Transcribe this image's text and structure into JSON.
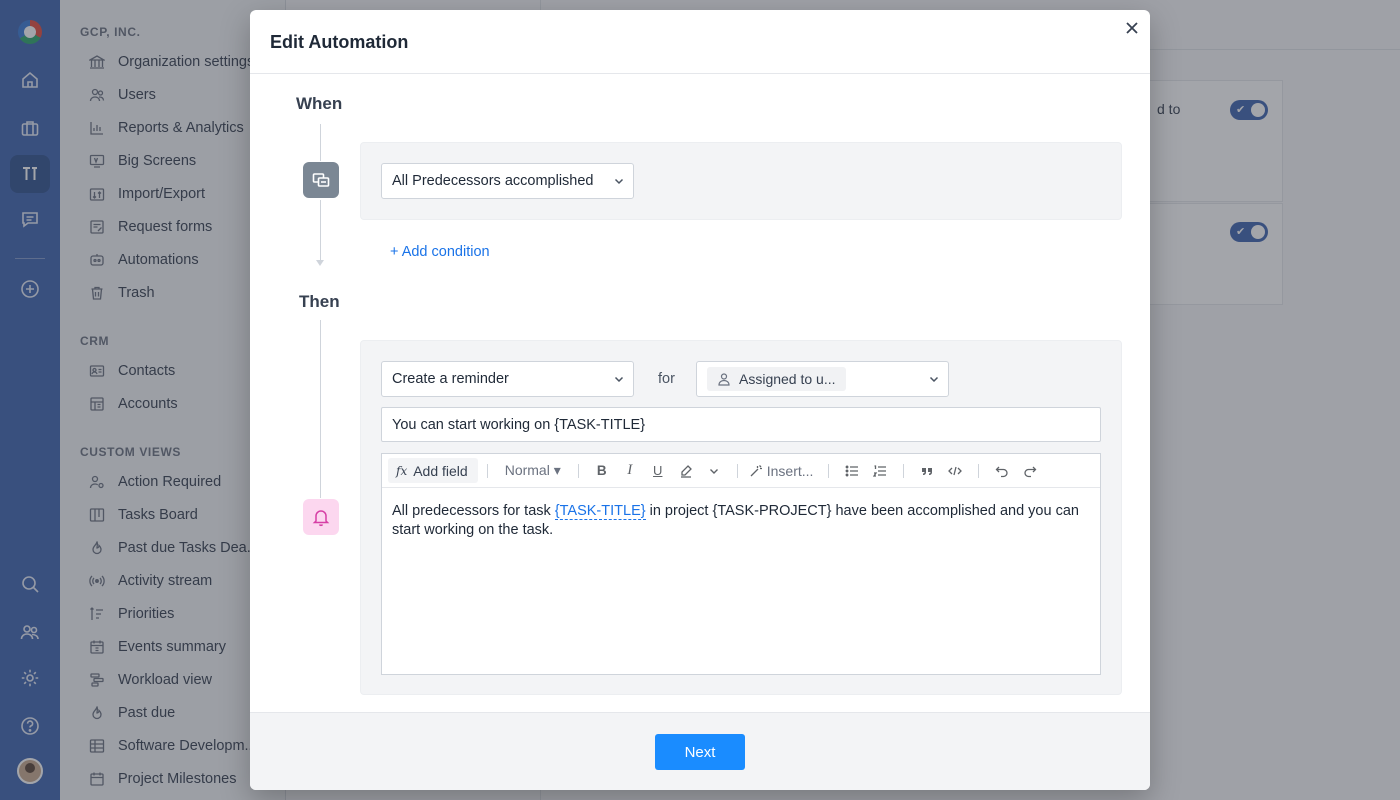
{
  "sidebar": {
    "org": "GCP, INC.",
    "org_items": [
      {
        "label": "Organization settings",
        "icon": "bank-icon"
      },
      {
        "label": "Users",
        "icon": "users-icon"
      },
      {
        "label": "Reports & Analytics",
        "icon": "bar-chart-icon"
      },
      {
        "label": "Big Screens",
        "icon": "tv-icon"
      },
      {
        "label": "Import/Export",
        "icon": "import-export-icon"
      },
      {
        "label": "Request forms",
        "icon": "form-icon"
      },
      {
        "label": "Automations",
        "icon": "robot-icon"
      },
      {
        "label": "Trash",
        "icon": "trash-icon"
      }
    ],
    "crm_title": "CRM",
    "crm_items": [
      {
        "label": "Contacts",
        "icon": "contact-card-icon"
      },
      {
        "label": "Accounts",
        "icon": "building-icon"
      }
    ],
    "views_title": "CUSTOM VIEWS",
    "view_items": [
      {
        "label": "Action Required",
        "icon": "user-gear-icon"
      },
      {
        "label": "Tasks Board",
        "icon": "board-icon"
      },
      {
        "label": "Past due Tasks Dea...",
        "icon": "flame-icon"
      },
      {
        "label": "Activity stream",
        "icon": "broadcast-icon"
      },
      {
        "label": "Priorities",
        "icon": "priority-icon"
      },
      {
        "label": "Events summary",
        "icon": "calendar-icon"
      },
      {
        "label": "Workload view",
        "icon": "workload-icon"
      },
      {
        "label": "Past due",
        "icon": "flame-icon"
      },
      {
        "label": "Software Developm...",
        "icon": "table-icon"
      },
      {
        "label": "Project Milestones",
        "icon": "calendar-icon"
      }
    ]
  },
  "background": {
    "card_text": "d to"
  },
  "modal": {
    "title": "Edit Automation",
    "when_label": "When",
    "then_label": "Then",
    "trigger": {
      "selected": "All Predecessors accomplished"
    },
    "add_condition": "+ Add condition",
    "action": {
      "selected": "Create a reminder"
    },
    "for_label": "for",
    "assignee": {
      "chip": "Assigned to u..."
    },
    "subject": "You can start working on {TASK-TITLE}",
    "toolbar": {
      "add_field": "Add field",
      "style": "Normal ▾",
      "bold": "B",
      "italic": "I",
      "underline": "U",
      "insert": "Insert..."
    },
    "body": {
      "part1": "All predecessors for task ",
      "token": "{TASK-TITLE}",
      "part2": " in project {TASK-PROJECT} have been accomplished and you can start working on the task."
    },
    "next_button": "Next"
  },
  "colors": {
    "rail": "#3f64b0",
    "accent": "#1a8cff",
    "link": "#1a73e8",
    "bell": "#d63fa5"
  }
}
